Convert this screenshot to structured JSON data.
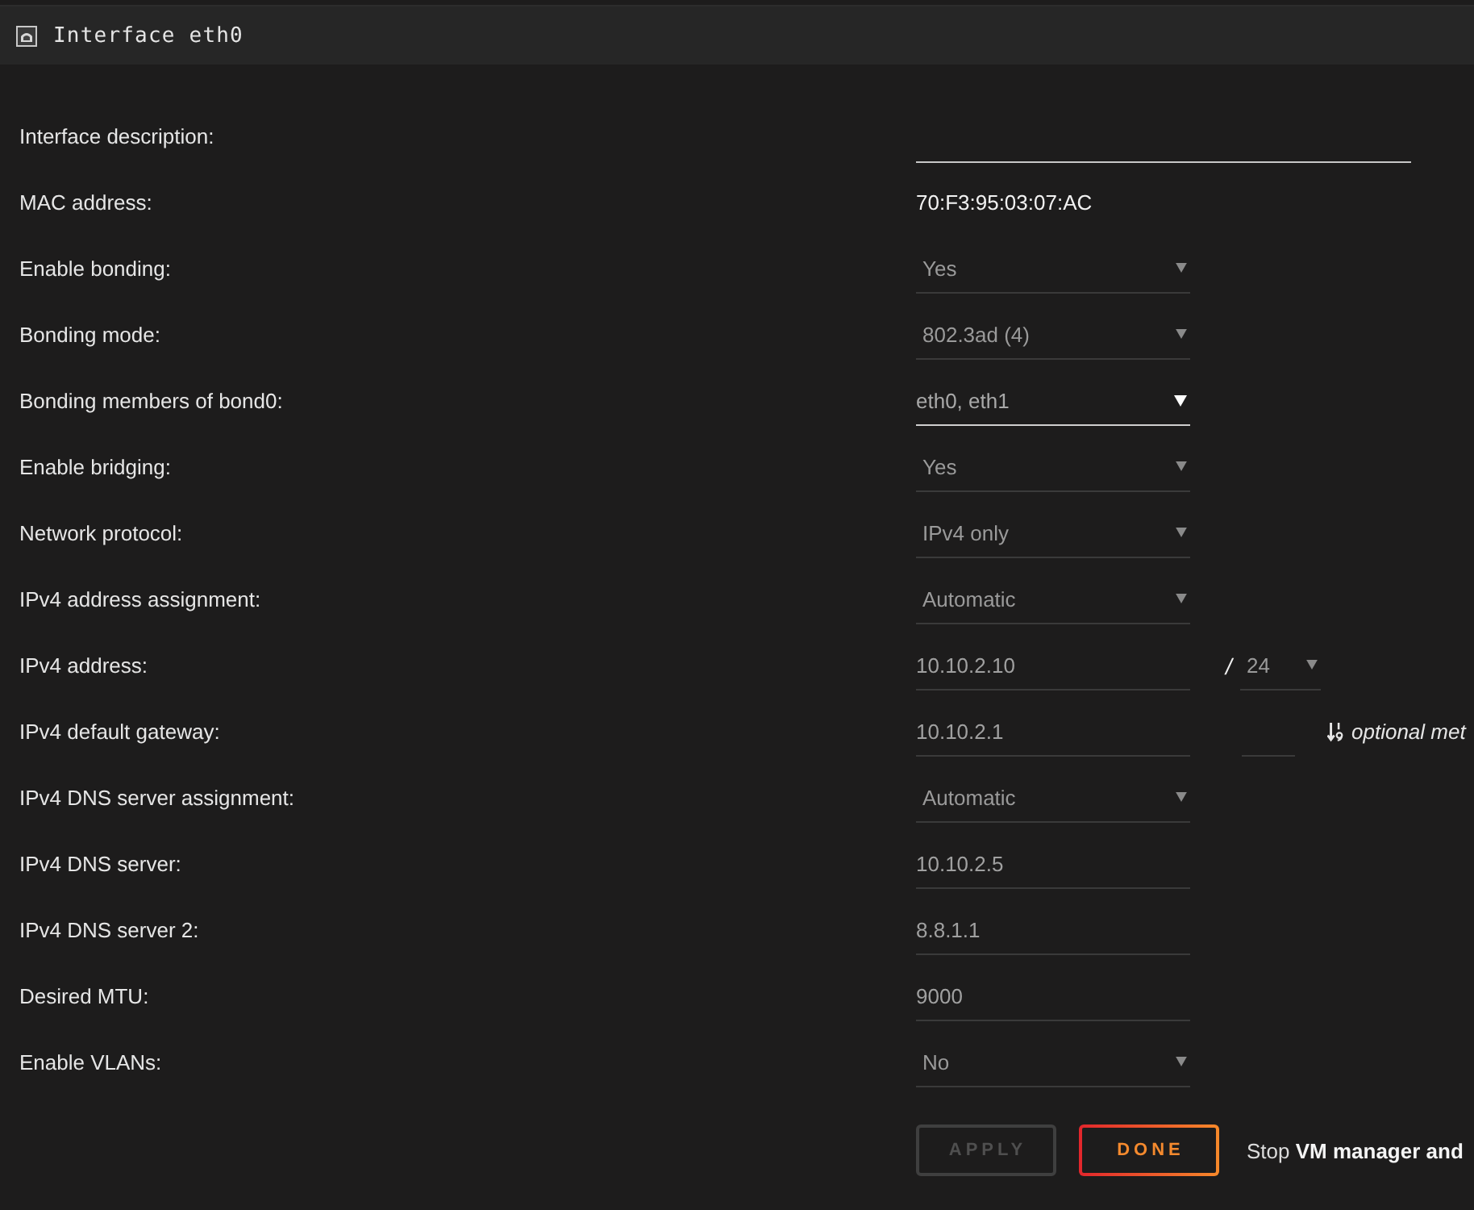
{
  "window": {
    "title": "Interface eth0"
  },
  "fields": [
    {
      "label": "Interface description:",
      "kind": "wideinput"
    },
    {
      "label": "MAC address:",
      "kind": "static",
      "value": "70:F3:95:03:07:AC"
    },
    {
      "label": "Enable bonding:",
      "kind": "select",
      "value": "Yes"
    },
    {
      "label": "Bonding mode:",
      "kind": "select",
      "value": "802.3ad (4)"
    },
    {
      "label": "Bonding members of bond0:",
      "kind": "multiselect",
      "value": "eth0, eth1"
    },
    {
      "label": "Enable bridging:",
      "kind": "select",
      "value": "Yes"
    },
    {
      "label": "Network protocol:",
      "kind": "select",
      "value": "IPv4 only"
    },
    {
      "label": "IPv4 address assignment:",
      "kind": "select",
      "value": "Automatic"
    },
    {
      "label": "IPv4 address:",
      "kind": "input",
      "value": "10.10.2.10",
      "extras": [
        {
          "kind": "separator",
          "text": "/"
        },
        {
          "kind": "select",
          "value": "24"
        }
      ]
    },
    {
      "label": "IPv4 default gateway:",
      "kind": "input",
      "value": "10.10.2.1",
      "extras": [
        {
          "kind": "input"
        },
        {
          "kind": "hint",
          "text": "optional met"
        }
      ]
    },
    {
      "label": "IPv4 DNS server assignment:",
      "kind": "select",
      "value": "Automatic"
    },
    {
      "label": "IPv4 DNS server:",
      "kind": "input",
      "value": "10.10.2.5"
    },
    {
      "label": "IPv4 DNS server 2:",
      "kind": "input",
      "value": "8.8.1.1"
    },
    {
      "label": "Desired MTU:",
      "kind": "input",
      "value": "9000"
    },
    {
      "label": "Enable VLANs:",
      "kind": "select",
      "value": "No"
    }
  ],
  "buttons": [
    {
      "label": "APPLY",
      "disabled": true
    },
    {
      "label": "DONE",
      "disabled": false
    }
  ],
  "note": "Stop **VM manager and**"
}
